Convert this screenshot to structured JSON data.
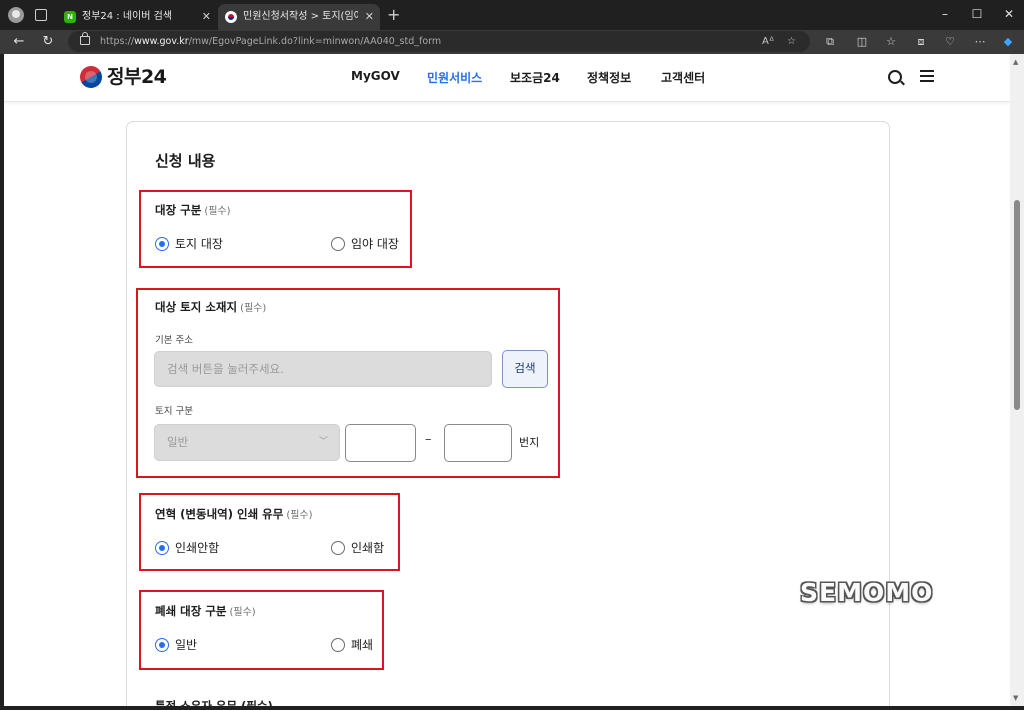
{
  "browser": {
    "tabs": [
      {
        "title": "정부24 : 네이버 검색",
        "favicon": "naver-n-icon",
        "favicon_text": "N"
      },
      {
        "title": "민원신청서작성 > 토지(임야)대장",
        "favicon": "gov-emblem-icon",
        "active": true
      }
    ],
    "url_prefix": "https://",
    "url_host": "www.gov.kr",
    "url_path": "/mw/EgovPageLink.do?link=minwon/AA040_std_form"
  },
  "header": {
    "logo_text": "정부24",
    "nav": [
      "MyGOV",
      "민원서비스",
      "보조금24",
      "정책정보",
      "고객센터"
    ],
    "active_nav": "민원서비스"
  },
  "form": {
    "title": "신청 내용",
    "required_text": "(필수)",
    "ledger_type": {
      "label": "대장 구분",
      "options": [
        "토지 대장",
        "임야 대장"
      ],
      "selected": "토지 대장"
    },
    "land_location": {
      "label": "대상 토지 소재지",
      "address_label": "기본 주소",
      "address_placeholder": "검색 버튼을 눌러주세요.",
      "search_button": "검색",
      "land_type_label": "토지 구분",
      "land_type_value": "일반",
      "dash": "–",
      "unit": "번지"
    },
    "history_print": {
      "label": "연혁 (변동내역) 인쇄 유무",
      "options": [
        "인쇄안함",
        "인쇄함"
      ],
      "selected": "인쇄안함"
    },
    "closed_ledger": {
      "label": "폐쇄 대장 구분",
      "options": [
        "일반",
        "폐쇄"
      ],
      "selected": "일반"
    },
    "next_label": "특정 소유자 유무 (필수)"
  },
  "watermark": "SEMOMO",
  "colors": {
    "accent": "#256ef4",
    "highlight_box": "#d8171f"
  }
}
